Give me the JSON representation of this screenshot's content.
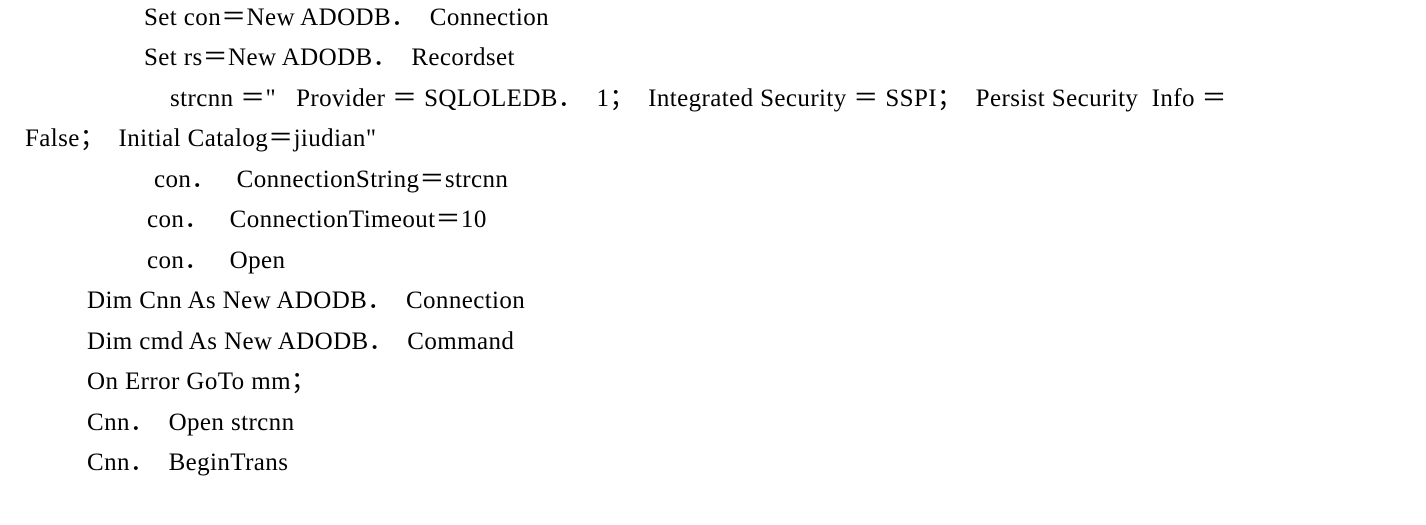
{
  "document": {
    "kind": "scanned-code-listing",
    "language": "Visual Basic",
    "background_color": "#ffffff",
    "text_color": "#000000",
    "lines": [
      {
        "text": "Set con＝New ADODB．  Connection",
        "indent": "ind-145"
      },
      {
        "text": "Set rs＝New ADODB．  Recordset",
        "indent": "ind-145"
      },
      {
        "text": "strcnn ＝\"   Provider ＝ SQLOLEDB．  1；  Integrated Security ＝ SSPI；  Persist Security  Info ＝",
        "indent": "ind-170"
      },
      {
        "text": "False；  Initial Catalog＝jiudian\"",
        "indent": "ind-26"
      },
      {
        "text": "con．   ConnectionString＝strcnn",
        "indent": "ind-155"
      },
      {
        "text": "con．   ConnectionTimeout＝10",
        "indent": "ind-148"
      },
      {
        "text": "con．   Open",
        "indent": "ind-148"
      },
      {
        "text": "Dim Cnn As New ADODB．  Connection",
        "indent": "ind-88"
      },
      {
        "text": "Dim cmd As New ADODB．  Command",
        "indent": "ind-88"
      },
      {
        "text": "On Error GoTo mm；",
        "indent": "ind-88"
      },
      {
        "text": "Cnn．  Open strcnn",
        "indent": "ind-88"
      },
      {
        "text": "Cnn．  BeginTrans",
        "indent": "ind-88"
      }
    ]
  }
}
